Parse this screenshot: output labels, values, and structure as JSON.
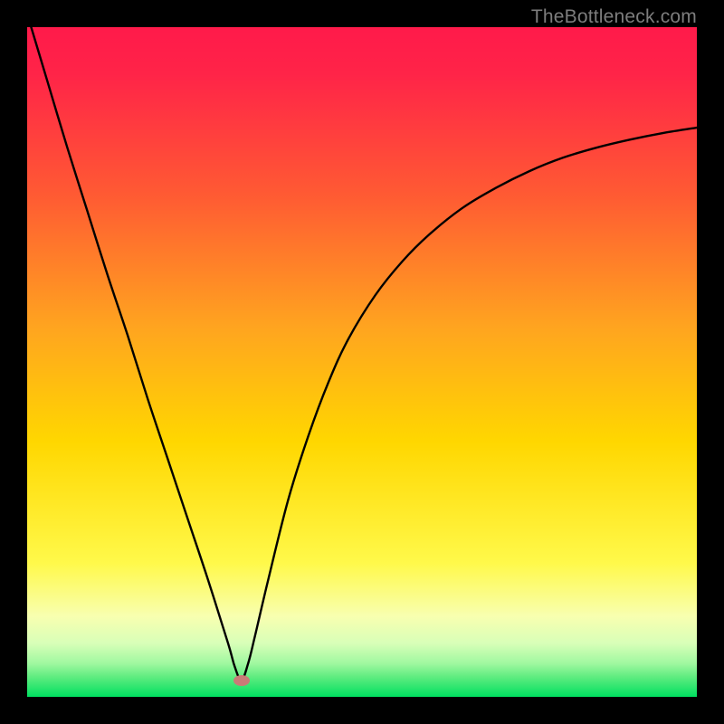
{
  "watermark": "TheBottleneck.com",
  "colors": {
    "frame": "#000000",
    "gradient_top": "#ff1a4a",
    "gradient_mid1": "#ff6a2a",
    "gradient_mid2": "#ffd700",
    "gradient_mid3": "#faff8a",
    "gradient_bottom": "#00e060",
    "curve": "#000000",
    "marker": "#c97b77"
  },
  "chart_data": {
    "type": "line",
    "title": "",
    "xlabel": "",
    "ylabel": "",
    "annotations": [
      "TheBottleneck.com"
    ],
    "marker": {
      "x": 0.32,
      "y": 0.975
    },
    "series": [
      {
        "name": "bottleneck-curve",
        "x": [
          0.0,
          0.03,
          0.06,
          0.09,
          0.12,
          0.15,
          0.18,
          0.21,
          0.24,
          0.27,
          0.3,
          0.31,
          0.32,
          0.33,
          0.34,
          0.36,
          0.39,
          0.42,
          0.45,
          0.48,
          0.52,
          0.56,
          0.6,
          0.65,
          0.7,
          0.75,
          0.8,
          0.85,
          0.9,
          0.95,
          1.0
        ],
        "y": [
          1.02,
          0.92,
          0.82,
          0.725,
          0.63,
          0.54,
          0.445,
          0.355,
          0.265,
          0.175,
          0.08,
          0.045,
          0.025,
          0.05,
          0.09,
          0.175,
          0.295,
          0.39,
          0.47,
          0.535,
          0.6,
          0.65,
          0.69,
          0.73,
          0.76,
          0.785,
          0.805,
          0.82,
          0.832,
          0.842,
          0.85
        ]
      }
    ],
    "xlim": [
      0,
      1
    ],
    "ylim": [
      0,
      1
    ]
  }
}
